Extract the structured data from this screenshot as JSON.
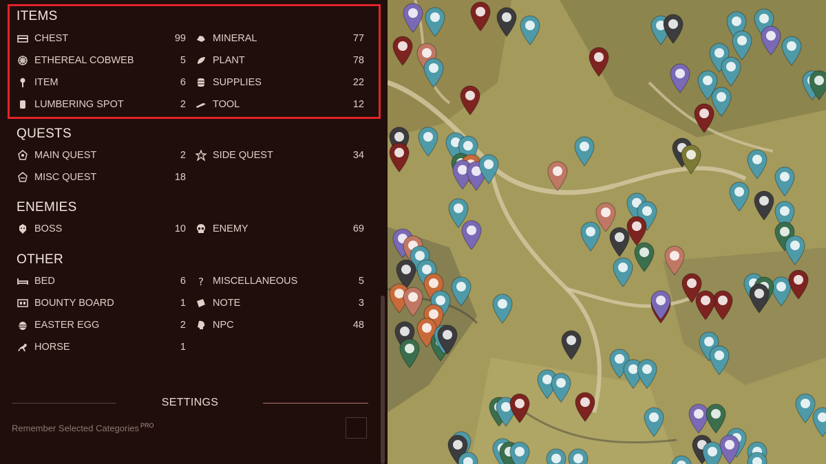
{
  "sidebar": {
    "sections": [
      {
        "title": "ITEMS",
        "items": [
          {
            "label": "CHEST",
            "count": "99",
            "icon": "chest-icon"
          },
          {
            "label": "MINERAL",
            "count": "77",
            "icon": "mineral-icon"
          },
          {
            "label": "ETHEREAL COBWEB",
            "count": "5",
            "icon": "cobweb-icon"
          },
          {
            "label": "PLANT",
            "count": "78",
            "icon": "plant-icon"
          },
          {
            "label": "ITEM",
            "count": "6",
            "icon": "item-icon"
          },
          {
            "label": "SUPPLIES",
            "count": "22",
            "icon": "barrel-icon"
          },
          {
            "label": "LUMBERING SPOT",
            "count": "2",
            "icon": "log-icon"
          },
          {
            "label": "TOOL",
            "count": "12",
            "icon": "tool-icon"
          }
        ]
      },
      {
        "title": "QUESTS",
        "items": [
          {
            "label": "MAIN QUEST",
            "count": "2",
            "icon": "main-quest-icon"
          },
          {
            "label": "SIDE QUEST",
            "count": "34",
            "icon": "side-quest-icon"
          },
          {
            "label": "MISC QUEST",
            "count": "18",
            "icon": "misc-quest-icon"
          }
        ]
      },
      {
        "title": "ENEMIES",
        "items": [
          {
            "label": "BOSS",
            "count": "10",
            "icon": "boss-icon"
          },
          {
            "label": "ENEMY",
            "count": "69",
            "icon": "skull-icon"
          }
        ]
      },
      {
        "title": "OTHER",
        "items": [
          {
            "label": "BED",
            "count": "6",
            "icon": "bed-icon"
          },
          {
            "label": "MISCELLANEOUS",
            "count": "5",
            "icon": "question-icon"
          },
          {
            "label": "BOUNTY BOARD",
            "count": "1",
            "icon": "board-icon"
          },
          {
            "label": "NOTE",
            "count": "3",
            "icon": "note-icon"
          },
          {
            "label": "EASTER EGG",
            "count": "2",
            "icon": "egg-icon"
          },
          {
            "label": "NPC",
            "count": "48",
            "icon": "npc-icon"
          },
          {
            "label": "HORSE",
            "count": "1",
            "icon": "horse-icon"
          }
        ]
      }
    ],
    "settings": {
      "title": "SETTINGS",
      "remember_label": "Remember Selected Categories",
      "pro_badge": "PRO"
    }
  },
  "colors": {
    "sidebar_bg": "#200e0c",
    "highlight": "#e0242a",
    "pin_teal": "#4e9aa8",
    "pin_red": "#7d2320",
    "pin_purple": "#7a69b5",
    "pin_green": "#3a6e4c",
    "pin_orange": "#c86a3a",
    "pin_salmon": "#c07865",
    "pin_gray": "#3c3b3d",
    "pin_olive": "#7c7a34"
  }
}
